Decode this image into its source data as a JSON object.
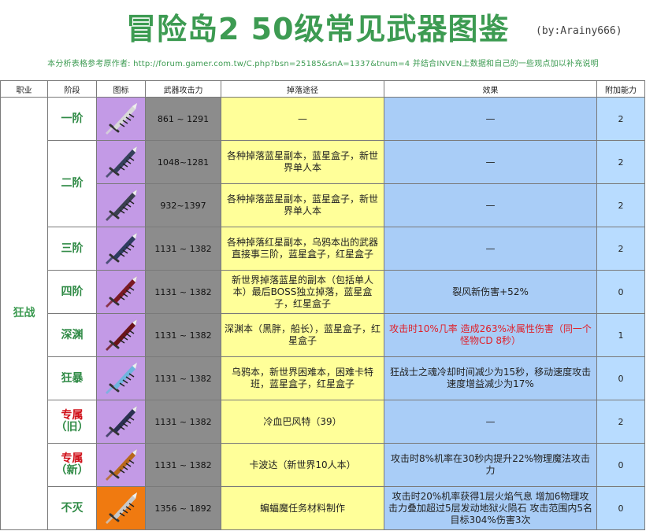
{
  "header": {
    "title": "冒险岛2 50级常见武器图鉴",
    "byline": "(by:Arainy666)",
    "source_note": "本分析表格参考原作者: http://forum.gamer.com.tw/C.php?bsn=25185&snA=1337&tnum=4 并结合INVEN上数据和自己的一些观点加以补充说明"
  },
  "table": {
    "columns": [
      "职业",
      "阶段",
      "图标",
      "武器攻击力",
      "掉落途径",
      "效果",
      "附加能力"
    ],
    "job": "狂战",
    "rows": [
      {
        "stage": "一阶",
        "icon": "white-greatsword-icon",
        "attack": "861 ~ 1291",
        "drop": "—",
        "effect": "—",
        "bonus": "2"
      },
      {
        "stage": "二阶",
        "icon": "dark-greatsword-icon",
        "attack": "1048~1281",
        "drop": "各种掉落蓝星副本，蓝星盒子，新世界单人本",
        "effect": "—",
        "bonus": "2"
      },
      {
        "stage": "",
        "icon": "dark-greatsword-icon",
        "attack": "932~1397",
        "drop": "各种掉落蓝星副本，蓝星盒子，新世界单人本",
        "effect": "—",
        "bonus": "2"
      },
      {
        "stage": "三阶",
        "icon": "dark-greatsword-icon",
        "attack": "1131 ~ 1382",
        "drop": "各种掉落红星副本，乌鸦本出的武器直接事三阶，蓝星盒子，红星盒子",
        "effect": "—",
        "bonus": "2"
      },
      {
        "stage": "四阶",
        "icon": "crimson-greatsword-icon",
        "attack": "1131 ~ 1382",
        "drop": "新世界掉落蓝星的副本（包括单人本）最后BOSS独立掉落，蓝星盒子，红星盒子",
        "effect": "裂风新伤害+52%",
        "bonus": "0"
      },
      {
        "stage": "深渊",
        "icon": "crimson-greatsword-icon",
        "attack": "1131 ~ 1382",
        "drop": "深渊本（黑胖，船长），蓝星盒子，红星盒子",
        "effect": "攻击时10%几率 造成263%冰属性伤害（同一个怪物CD 8秒）",
        "effect_red": true,
        "bonus": "1"
      },
      {
        "stage": "狂暴",
        "icon": "ice-greatsword-icon",
        "attack": "1131 ~ 1382",
        "drop": "乌鸦本，新世界困难本，困难卡特班，蓝星盒子，红星盒子",
        "effect": "狂战士之魂冷却时间减少为15秒，移动速度攻击速度增益减少为17%",
        "bonus": "0"
      },
      {
        "stage_top": "专属",
        "stage_bottom": "（旧）",
        "stage_style": "red-green",
        "icon": "chain-greatsword-icon",
        "attack": "1131 ~ 1382",
        "drop": "冷血巴风特（39）",
        "effect": "—",
        "bonus": "2"
      },
      {
        "stage_top": "专属",
        "stage_bottom": "（新）",
        "stage_style": "red-green",
        "icon": "golden-greatsword-icon",
        "attack": "1131 ~ 1382",
        "drop": "卡波达（新世界10人本）",
        "effect": "攻击时8%机率在30秒内提升22%物理魔法攻击力",
        "bonus": "0"
      },
      {
        "stage": "不灭",
        "icon": "silver-greatsword-icon",
        "icon_bg": "orange",
        "attack": "1356 ~ 1892",
        "drop": "蝙蝠魔任务材料制作",
        "effect": "攻击时20%机率获得1层火焰气息 增加6物理攻击力叠加超过5层发动地狱火陨石 攻击范围内5名目标304%伤害3次",
        "bonus": "0"
      }
    ]
  }
}
